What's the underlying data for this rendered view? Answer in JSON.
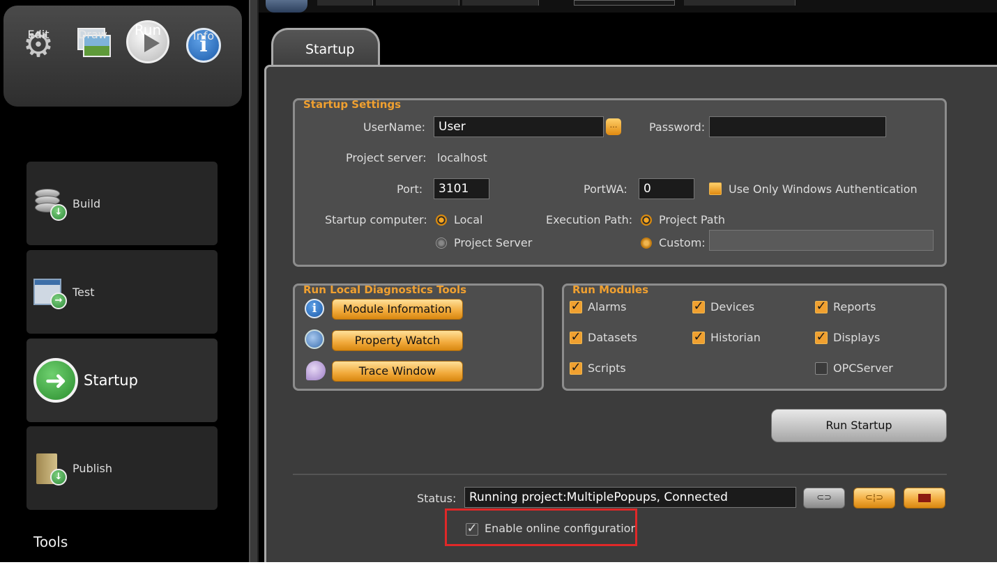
{
  "top_nav": {
    "edit_label": "Edit",
    "draw_label": "Draw",
    "run_label": "Run",
    "info_label": "Info"
  },
  "sidebar": {
    "items": [
      {
        "label": "Build",
        "icon": "database-icon"
      },
      {
        "label": "Test",
        "icon": "test-window-icon"
      },
      {
        "label": "Startup",
        "icon": "startup-arrow-icon",
        "active": true
      },
      {
        "label": "Publish",
        "icon": "publish-icon"
      }
    ],
    "tools_label": "Tools"
  },
  "tabs": {
    "startup": "Startup"
  },
  "startup_settings": {
    "title": "Startup Settings",
    "username_label": "UserName:",
    "username_value": "User",
    "password_label": "Password:",
    "password_value": "",
    "project_server_label": "Project server:",
    "project_server_value": "localhost",
    "port_label": "Port:",
    "port_value": "3101",
    "portwa_label": "PortWA:",
    "portwa_value": "0",
    "windows_auth_label": "Use Only Windows Authentication",
    "startup_computer_label": "Startup computer:",
    "startup_local_label": "Local",
    "startup_project_server_label": "Project Server",
    "execution_path_label": "Execution Path:",
    "exec_project_path_label": "Project Path",
    "exec_custom_label": "Custom:",
    "custom_value": ""
  },
  "diagnostics": {
    "title": "Run Local Diagnostics Tools",
    "buttons": [
      "Module Information",
      "Property Watch",
      "Trace Window"
    ]
  },
  "run_modules": {
    "title": "Run Modules",
    "modules": [
      {
        "label": "Alarms",
        "checked": true
      },
      {
        "label": "Devices",
        "checked": true
      },
      {
        "label": "Reports",
        "checked": true
      },
      {
        "label": "Datasets",
        "checked": true
      },
      {
        "label": "Historian",
        "checked": true
      },
      {
        "label": "Displays",
        "checked": true
      },
      {
        "label": "Scripts",
        "checked": true
      },
      {
        "label": "OPCServer",
        "checked": false
      }
    ]
  },
  "run_startup_label": "Run Startup",
  "status": {
    "label": "Status:",
    "value": "Running project:MultiplePopups, Connected"
  },
  "online_config": {
    "label": "Enable online configuration",
    "checked": true
  },
  "colors": {
    "accent": "#f0a030",
    "highlight_box": "#e02828"
  }
}
